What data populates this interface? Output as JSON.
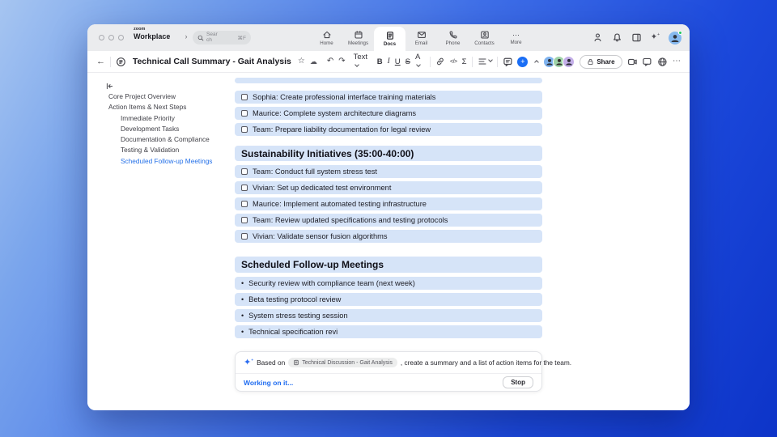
{
  "topbar": {
    "logo_small": "zoom",
    "logo_bold": "Workplace",
    "history_nav": "‹ ›",
    "search": {
      "placeholder": "Search",
      "shortcut": "⌘F"
    },
    "nav_items": [
      {
        "label": "Home"
      },
      {
        "label": "Meetings"
      },
      {
        "label": "Docs"
      },
      {
        "label": "Email"
      },
      {
        "label": "Phone"
      },
      {
        "label": "Contacts"
      },
      {
        "label": "More"
      }
    ]
  },
  "toolbar": {
    "title": "Technical Call Summary - Gait Analysis",
    "text_menu_label": "Text",
    "bold": "B",
    "italic": "I",
    "underline": "U",
    "strike": "S",
    "color": "A",
    "code": "</>",
    "sigma": "Σ",
    "share_label": "Share"
  },
  "glyphs": {
    "back": "←",
    "star": "☆",
    "cloud": "☁",
    "undo": "↶",
    "redo": "↷",
    "more": "⋯",
    "sparkle": "✦",
    "plus": "+",
    "bullet": "•"
  },
  "sidebar": {
    "items": [
      {
        "label": "Core Project Overview"
      },
      {
        "label": "Action Items & Next Steps"
      },
      {
        "label": "Immediate Priority"
      },
      {
        "label": "Development Tasks"
      },
      {
        "label": "Documentation & Compliance"
      },
      {
        "label": "Testing & Validation"
      },
      {
        "label": "Scheduled Follow-up Meetings"
      }
    ]
  },
  "document": {
    "top_checklist": [
      "Sophia: Create professional interface training materials",
      "Maurice: Complete system architecture diagrams",
      "Team: Prepare liability documentation for legal review"
    ],
    "sustainability": {
      "heading": "Sustainability Initiatives (35:00-40:00)",
      "items": [
        "Team: Conduct full system stress test",
        "Vivian: Set up dedicated test environment",
        "Maurice: Implement automated testing infrastructure",
        "Team: Review updated specifications and testing protocols",
        "Vivian: Validate sensor fusion algorithms"
      ]
    },
    "followups": {
      "heading": "Scheduled Follow-up Meetings",
      "items": [
        "Security review with compliance team (next week)",
        "Beta testing protocol review",
        "System stress testing session",
        "Technical specification revi"
      ]
    }
  },
  "ai_panel": {
    "prefix": "Based on",
    "source_chip": "Technical Discussion - Gait Analysis",
    "suffix": ", create a summary and a list of action items for the team.",
    "status": "Working on it...",
    "stop_label": "Stop"
  },
  "colors": {
    "accent": "#0b5cff",
    "highlight": "#d6e4f8",
    "link_blue": "#1f6cf0"
  }
}
